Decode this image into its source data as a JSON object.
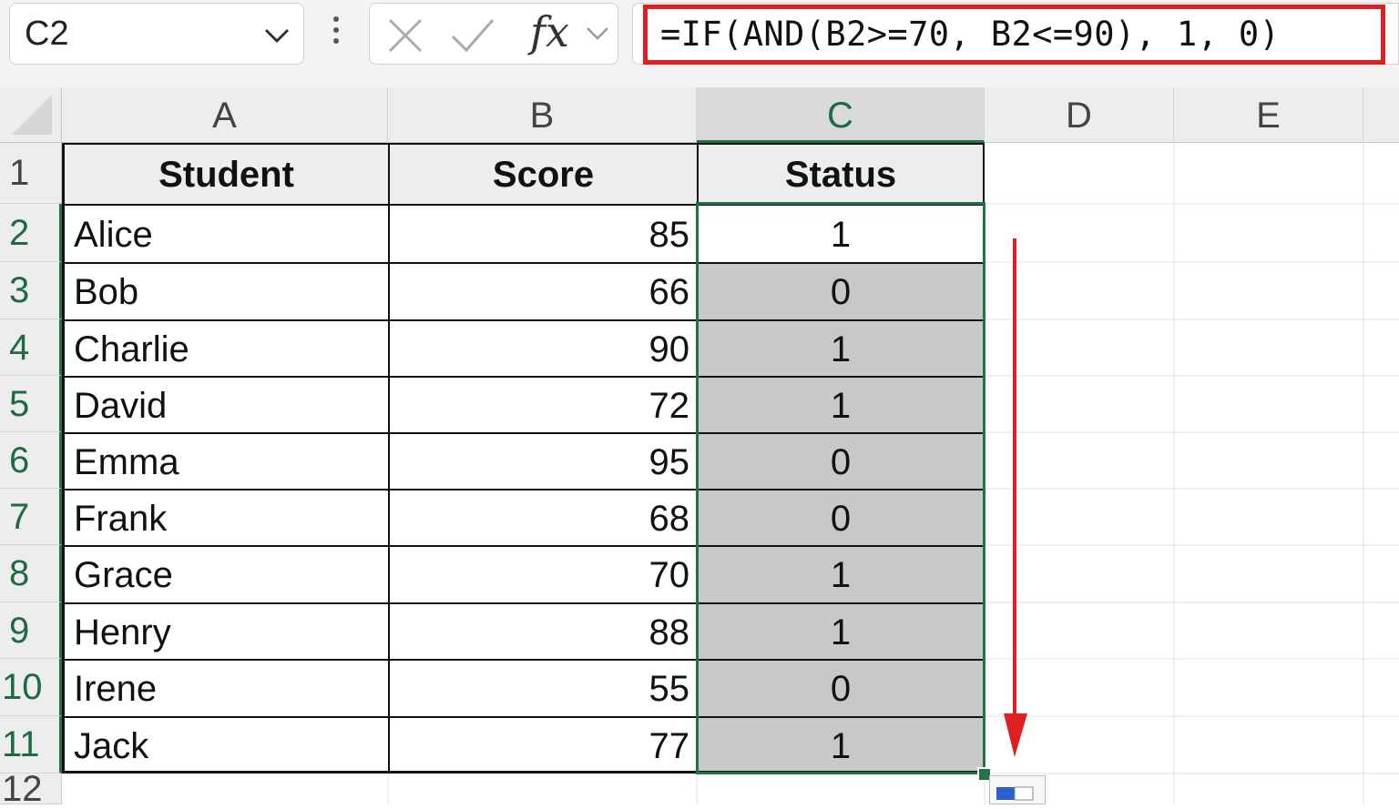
{
  "formula_bar": {
    "name_box": "C2",
    "fx_label": "fx",
    "formula": "=IF(AND(B2>=70, B2<=90), 1, 0)"
  },
  "columns": [
    "A",
    "B",
    "C",
    "D",
    "E"
  ],
  "row_numbers": [
    "1",
    "2",
    "3",
    "4",
    "5",
    "6",
    "7",
    "8",
    "9",
    "10",
    "11",
    "12"
  ],
  "table": {
    "headers": [
      "Student",
      "Score",
      "Status"
    ],
    "rows": [
      {
        "student": "Alice",
        "score": "85",
        "status": "1"
      },
      {
        "student": "Bob",
        "score": "66",
        "status": "0"
      },
      {
        "student": "Charlie",
        "score": "90",
        "status": "1"
      },
      {
        "student": "David",
        "score": "72",
        "status": "1"
      },
      {
        "student": "Emma",
        "score": "95",
        "status": "0"
      },
      {
        "student": "Frank",
        "score": "68",
        "status": "0"
      },
      {
        "student": "Grace",
        "score": "70",
        "status": "1"
      },
      {
        "student": "Henry",
        "score": "88",
        "status": "1"
      },
      {
        "student": "Irene",
        "score": "55",
        "status": "0"
      },
      {
        "student": "Jack",
        "score": "77",
        "status": "1"
      }
    ]
  },
  "colors": {
    "selection": "#217346",
    "highlight": "#e02020",
    "fill_gray": "#c8c8c8"
  },
  "icons": [
    "chevron-down-icon",
    "more-vertical-icon",
    "cancel-x-icon",
    "check-icon",
    "fx-icon",
    "arrow-down-icon",
    "quick-analysis-icon"
  ]
}
